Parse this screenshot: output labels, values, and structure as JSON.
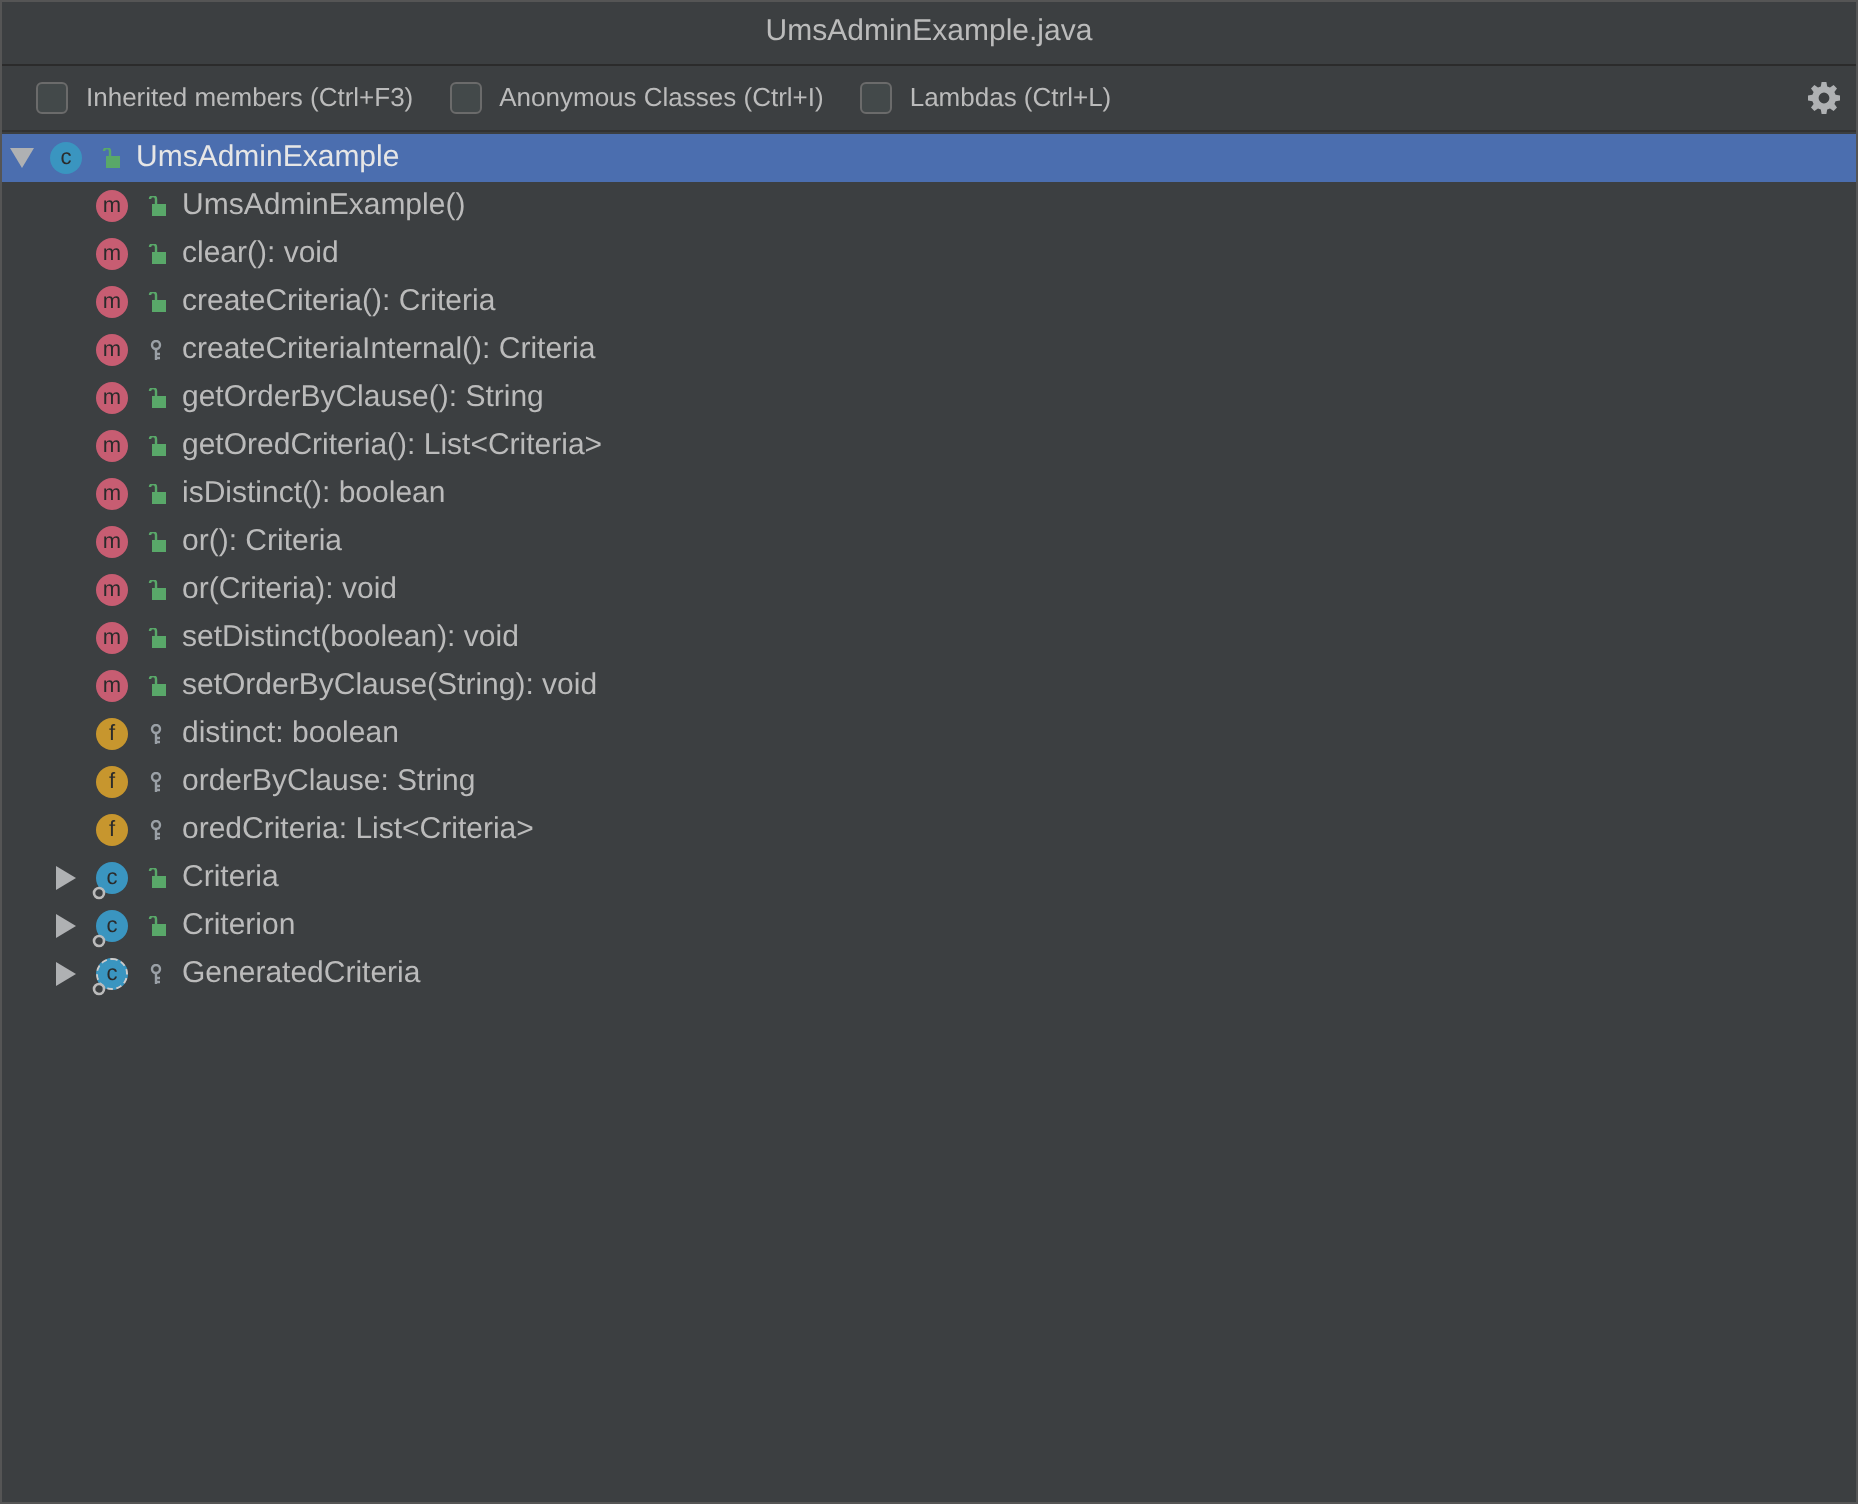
{
  "window": {
    "title": "UmsAdminExample.java"
  },
  "toolbar": {
    "options": [
      {
        "label": "Inherited members (Ctrl+F3)",
        "checked": false
      },
      {
        "label": "Anonymous Classes (Ctrl+I)",
        "checked": false
      },
      {
        "label": "Lambdas (Ctrl+L)",
        "checked": false
      }
    ]
  },
  "tree": [
    {
      "kind": "class",
      "badge": "c",
      "public": true,
      "label": "UmsAdminExample",
      "selected": true,
      "expanded": true,
      "children": [
        {
          "kind": "method",
          "badge": "m",
          "public": true,
          "label": "UmsAdminExample()",
          "selected": false
        },
        {
          "kind": "method",
          "badge": "m",
          "public": true,
          "label": "clear(): void",
          "selected": false
        },
        {
          "kind": "method",
          "badge": "m",
          "public": true,
          "label": "createCriteria(): Criteria",
          "selected": false
        },
        {
          "kind": "method",
          "badge": "m",
          "public": false,
          "label": "createCriteriaInternal(): Criteria",
          "selected": false
        },
        {
          "kind": "method",
          "badge": "m",
          "public": true,
          "label": "getOrderByClause(): String",
          "selected": false
        },
        {
          "kind": "method",
          "badge": "m",
          "public": true,
          "label": "getOredCriteria(): List<Criteria>",
          "selected": false
        },
        {
          "kind": "method",
          "badge": "m",
          "public": true,
          "label": "isDistinct(): boolean",
          "selected": false
        },
        {
          "kind": "method",
          "badge": "m",
          "public": true,
          "label": "or(): Criteria",
          "selected": false
        },
        {
          "kind": "method",
          "badge": "m",
          "public": true,
          "label": "or(Criteria): void",
          "selected": false
        },
        {
          "kind": "method",
          "badge": "m",
          "public": true,
          "label": "setDistinct(boolean): void",
          "selected": false
        },
        {
          "kind": "method",
          "badge": "m",
          "public": true,
          "label": "setOrderByClause(String): void",
          "selected": false
        },
        {
          "kind": "field",
          "badge": "f",
          "public": false,
          "label": "distinct: boolean",
          "selected": false
        },
        {
          "kind": "field",
          "badge": "f",
          "public": false,
          "label": "orderByClause: String",
          "selected": false
        },
        {
          "kind": "field",
          "badge": "f",
          "public": false,
          "label": "oredCriteria: List<Criteria>",
          "selected": false
        },
        {
          "kind": "static_class",
          "badge": "c",
          "public": true,
          "label": "Criteria",
          "selected": false,
          "expanded": false
        },
        {
          "kind": "static_class",
          "badge": "c",
          "public": true,
          "label": "Criterion",
          "selected": false,
          "expanded": false
        },
        {
          "kind": "abstract_class",
          "badge": "c",
          "public": false,
          "label": "GeneratedCriteria",
          "selected": false,
          "expanded": false
        }
      ]
    }
  ]
}
